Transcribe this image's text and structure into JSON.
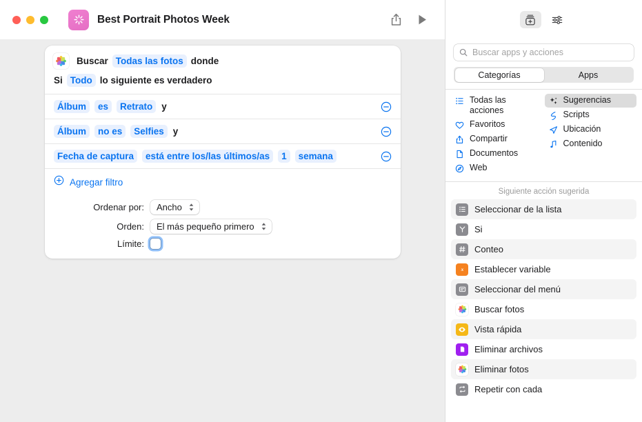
{
  "window": {
    "title": "Best Portrait Photos Week",
    "app_glyph": "shortcut-sparkle-icon",
    "traffic_lights": [
      "close",
      "minimize",
      "zoom"
    ],
    "share_label": "Compartir",
    "run_label": "Ejecutar"
  },
  "action_card": {
    "app_icon": "photos-icon",
    "verb": "Buscar",
    "target": "Todas las fotos",
    "where": "donde",
    "condition": {
      "prefix": "Si",
      "quantifier": "Todo",
      "suffix": "lo siguiente es verdadero"
    },
    "filters": [
      {
        "field": "Álbum",
        "operator": "es",
        "value": "Retrato",
        "conjunction": "y",
        "remove": "remove-filter"
      },
      {
        "field": "Álbum",
        "operator": "no es",
        "value": "Selfies",
        "conjunction": "y",
        "remove": "remove-filter"
      },
      {
        "field": "Fecha de captura",
        "operator": "está entre los/las últimos/as",
        "value": "1",
        "unit": "semana",
        "conjunction": "",
        "remove": "remove-filter"
      }
    ],
    "add_filter_label": "Agregar filtro",
    "options": {
      "sort_by_label": "Ordenar por:",
      "sort_by_value": "Ancho",
      "order_label": "Orden:",
      "order_value": "El más pequeño primero",
      "limit_label": "Límite:",
      "limit_checked": false
    }
  },
  "library": {
    "toolbar": {
      "actions_button": "action-library-icon",
      "settings_button": "sliders-icon"
    },
    "search": {
      "placeholder": "Buscar apps y acciones",
      "value": ""
    },
    "segments": [
      {
        "label": "Categorías",
        "selected": true
      },
      {
        "label": "Apps",
        "selected": false
      }
    ],
    "categories_left": [
      {
        "label": "Todas las acciones",
        "icon": "list-bullet-icon",
        "selected": false
      },
      {
        "label": "Favoritos",
        "icon": "heart-icon",
        "selected": false
      },
      {
        "label": "Compartir",
        "icon": "share-icon",
        "selected": false
      },
      {
        "label": "Documentos",
        "icon": "document-icon",
        "selected": false
      },
      {
        "label": "Web",
        "icon": "safari-compass-icon",
        "selected": false
      }
    ],
    "categories_right": [
      {
        "label": "Sugerencias",
        "icon": "sparkles-icon",
        "selected": true
      },
      {
        "label": "Scripts",
        "icon": "script-icon",
        "selected": false
      },
      {
        "label": "Ubicación",
        "icon": "location-arrow-icon",
        "selected": false
      },
      {
        "label": "Contenido",
        "icon": "music-note-icon",
        "selected": false
      }
    ],
    "suggestions_header": "Siguiente acción sugerida",
    "actions": [
      {
        "label": "Seleccionar de la lista",
        "icon": "list-icon",
        "icon_style": "gray",
        "glyph": "☰"
      },
      {
        "label": "Si",
        "icon": "branch-icon",
        "icon_style": "gray",
        "glyph": "Y"
      },
      {
        "label": "Conteo",
        "icon": "hash-icon",
        "icon_style": "gray",
        "glyph": "#"
      },
      {
        "label": "Establecer variable",
        "icon": "variable-icon",
        "icon_style": "orange",
        "glyph": "x"
      },
      {
        "label": "Seleccionar del menú",
        "icon": "menu-icon",
        "icon_style": "gray",
        "glyph": "▤"
      },
      {
        "label": "Buscar fotos",
        "icon": "photos-icon",
        "icon_style": "white",
        "glyph": ""
      },
      {
        "label": "Vista rápida",
        "icon": "eye-icon",
        "icon_style": "yellow",
        "glyph": "◉"
      },
      {
        "label": "Eliminar archivos",
        "icon": "file-icon",
        "icon_style": "purple",
        "glyph": "▯"
      },
      {
        "label": "Eliminar fotos",
        "icon": "photos-icon",
        "icon_style": "white",
        "glyph": ""
      },
      {
        "label": "Repetir con cada",
        "icon": "repeat-icon",
        "icon_style": "gray",
        "glyph": "⇄"
      }
    ]
  },
  "colors": {
    "accent_blue": "#0a74f0",
    "pill_bg": "#e8f0fe",
    "canvas": "#ededed",
    "selected_gray": "#dcdcdc"
  }
}
